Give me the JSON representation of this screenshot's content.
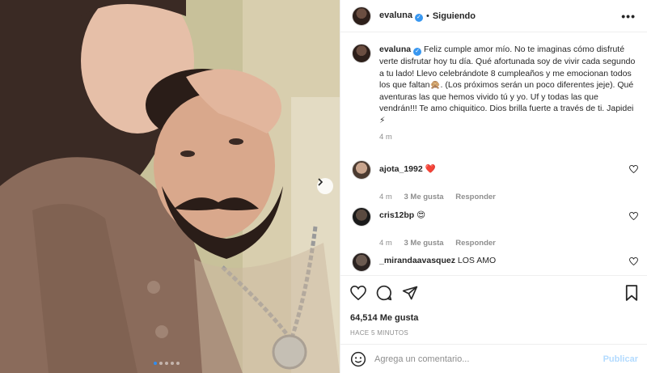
{
  "colors": {
    "accent": "#3897f0",
    "text": "#262626",
    "muted": "#8e8e8e",
    "like": "#ed4956",
    "publish_disabled": "#b3dbff"
  },
  "photo": {
    "carousel_dots": 5,
    "active_dot": 1
  },
  "header": {
    "username": "evaluna",
    "separator": "•",
    "follow_status": "Siguiendo",
    "more_label": "•••"
  },
  "caption": {
    "username": "evaluna",
    "text": "Feliz cumple amor mío. No te imaginas cómo disfruté verte disfrutar hoy tu día. Qué afortunada soy de vivir cada segundo a tu lado! Llevo celebrándote 8 cumpleaños y me emocionan todos los que faltan🙊. (Los próximos serán un poco diferentes jeje). Qué aventuras las que hemos vivido tú y yo. Uf y todas las que vendrán!!! Te amo chiquitico. Dios brilla fuerte a través de ti. Japidei ⚡",
    "time": "4 m"
  },
  "comments": [
    {
      "username": "ajota_1992",
      "text": "❤️",
      "time": "",
      "likes": "",
      "reply": ""
    },
    {
      "username": "",
      "text": "",
      "time": "4 m",
      "likes": "3 Me gusta",
      "reply": "Responder"
    },
    {
      "username": "cris12bp",
      "text": "😍",
      "time": "4 m",
      "likes": "3 Me gusta",
      "reply": "Responder"
    },
    {
      "username": "_mirandaavasquez",
      "text": "LOS AMO",
      "time": "",
      "likes": "",
      "reply": ""
    }
  ],
  "actions": {
    "likes": "64,514 Me gusta",
    "posted_ago": "HACE 5 MINUTOS"
  },
  "add_comment": {
    "placeholder": "Agrega un comentario...",
    "publish_label": "Publicar"
  },
  "icons": [
    "heart-icon",
    "comment-icon",
    "share-icon",
    "bookmark-icon",
    "emoji-icon",
    "chevron-right-icon",
    "more-icon",
    "verified-icon"
  ]
}
